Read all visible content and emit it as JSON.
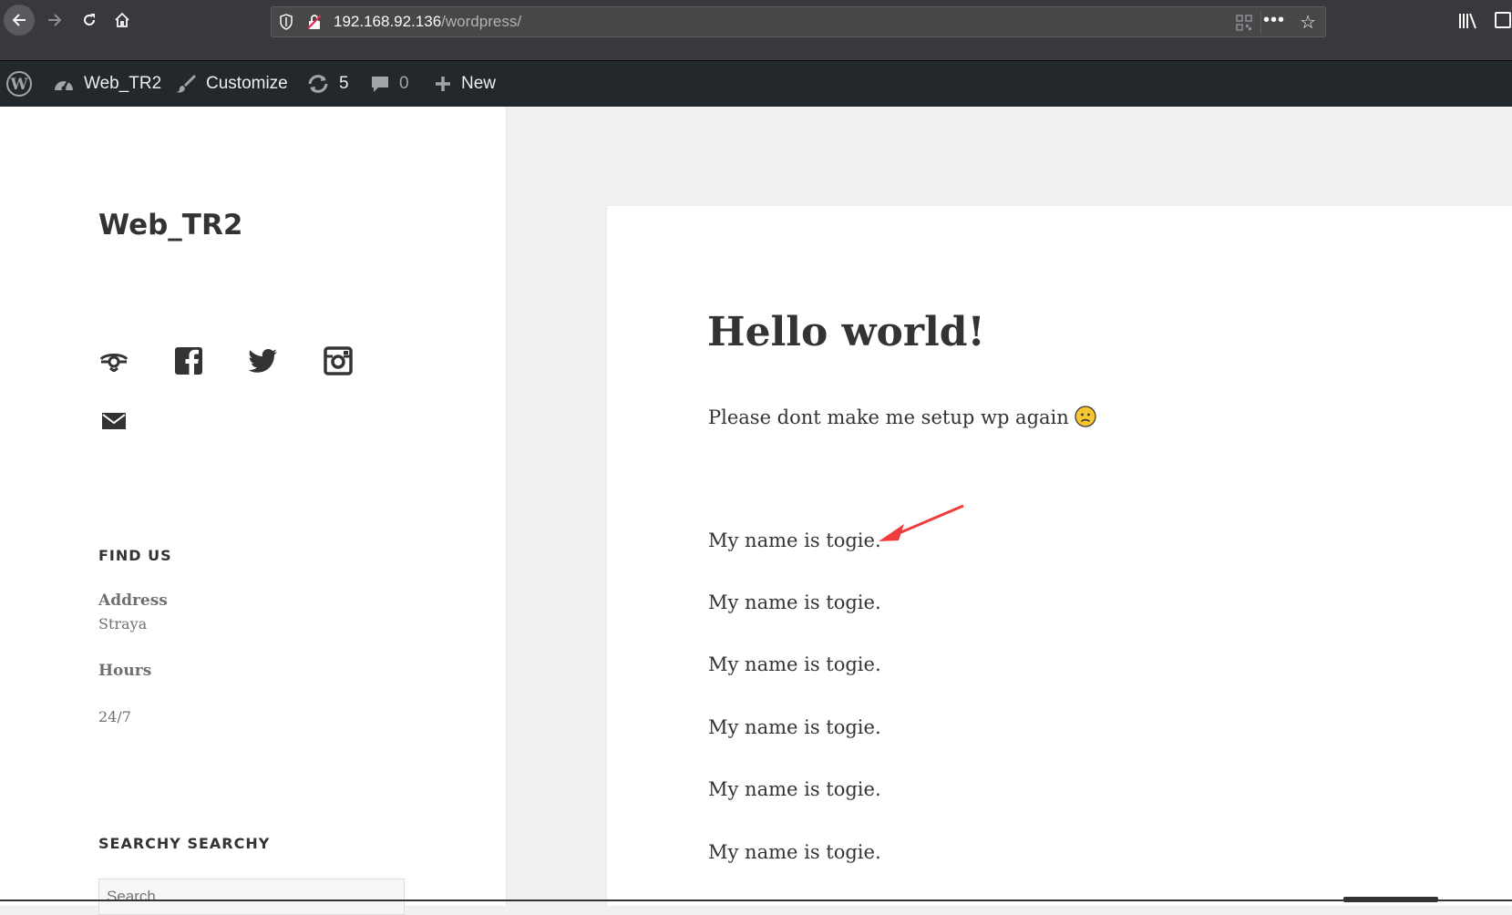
{
  "browser": {
    "url_host": "192.168.92.136",
    "url_path": "/wordpress/"
  },
  "adminbar": {
    "site_name": "Web_TR2",
    "customize": "Customize",
    "updates_count": "5",
    "comments_count": "0",
    "new_label": "New"
  },
  "sidebar": {
    "site_title": "Web_TR2",
    "social_icons": [
      "tripadvisor-icon",
      "facebook-icon",
      "twitter-icon",
      "instagram-icon",
      "email-icon"
    ],
    "find_us": {
      "title": "FIND US",
      "address_label": "Address",
      "address_value": "Straya",
      "hours_label": "Hours",
      "hours_value": "24/7"
    },
    "search": {
      "title": "SEARCHY SEARCHY",
      "placeholder": "Search …"
    }
  },
  "post": {
    "title": "Hello world!",
    "intro": "Please dont make me setup wp again",
    "lines": [
      "My name is togie.",
      "My name is togie.",
      "My name is togie.",
      "My name is togie.",
      "My name is togie.",
      "My name is togie."
    ]
  },
  "colors": {
    "adminbar_bg": "#23282d",
    "browser_bg": "#38383d",
    "annotation_arrow": "#f03c3c"
  }
}
